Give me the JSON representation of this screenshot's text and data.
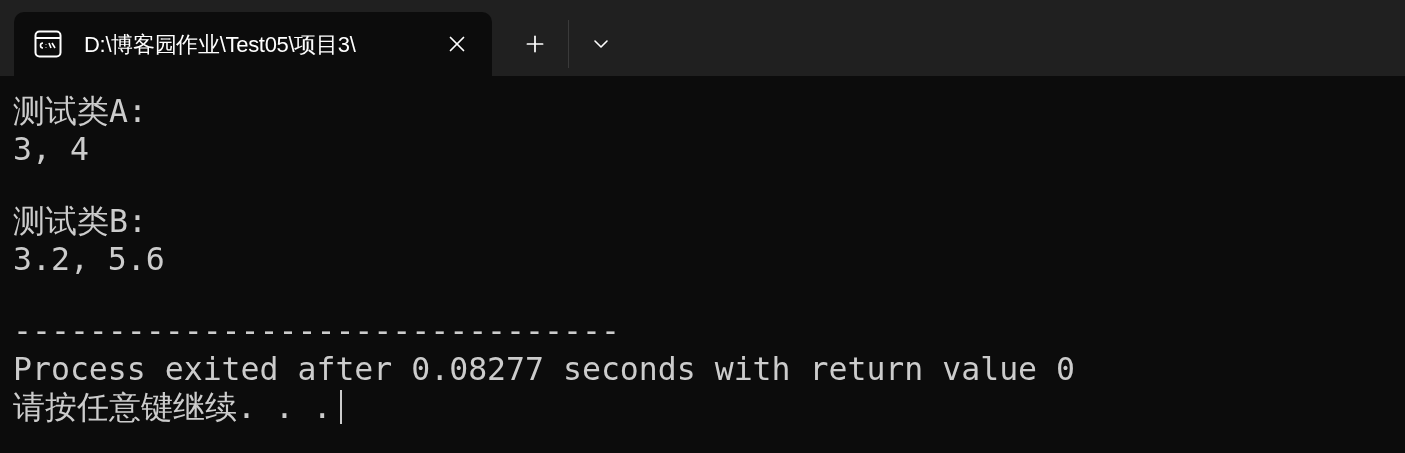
{
  "tabs": [
    {
      "title": "D:\\博客园作业\\Test05\\项目3\\",
      "selected": true
    }
  ],
  "terminal": {
    "blocks": [
      {
        "lines": [
          "测试类A:",
          "3, 4"
        ]
      },
      {
        "lines": [
          "测试类B:",
          "3.2, 5.6"
        ]
      },
      {
        "lines": [
          "--------------------------------",
          "Process exited after 0.08277 seconds with return value 0",
          "请按任意键继续. . ."
        ]
      }
    ],
    "cursor_visible": true
  }
}
